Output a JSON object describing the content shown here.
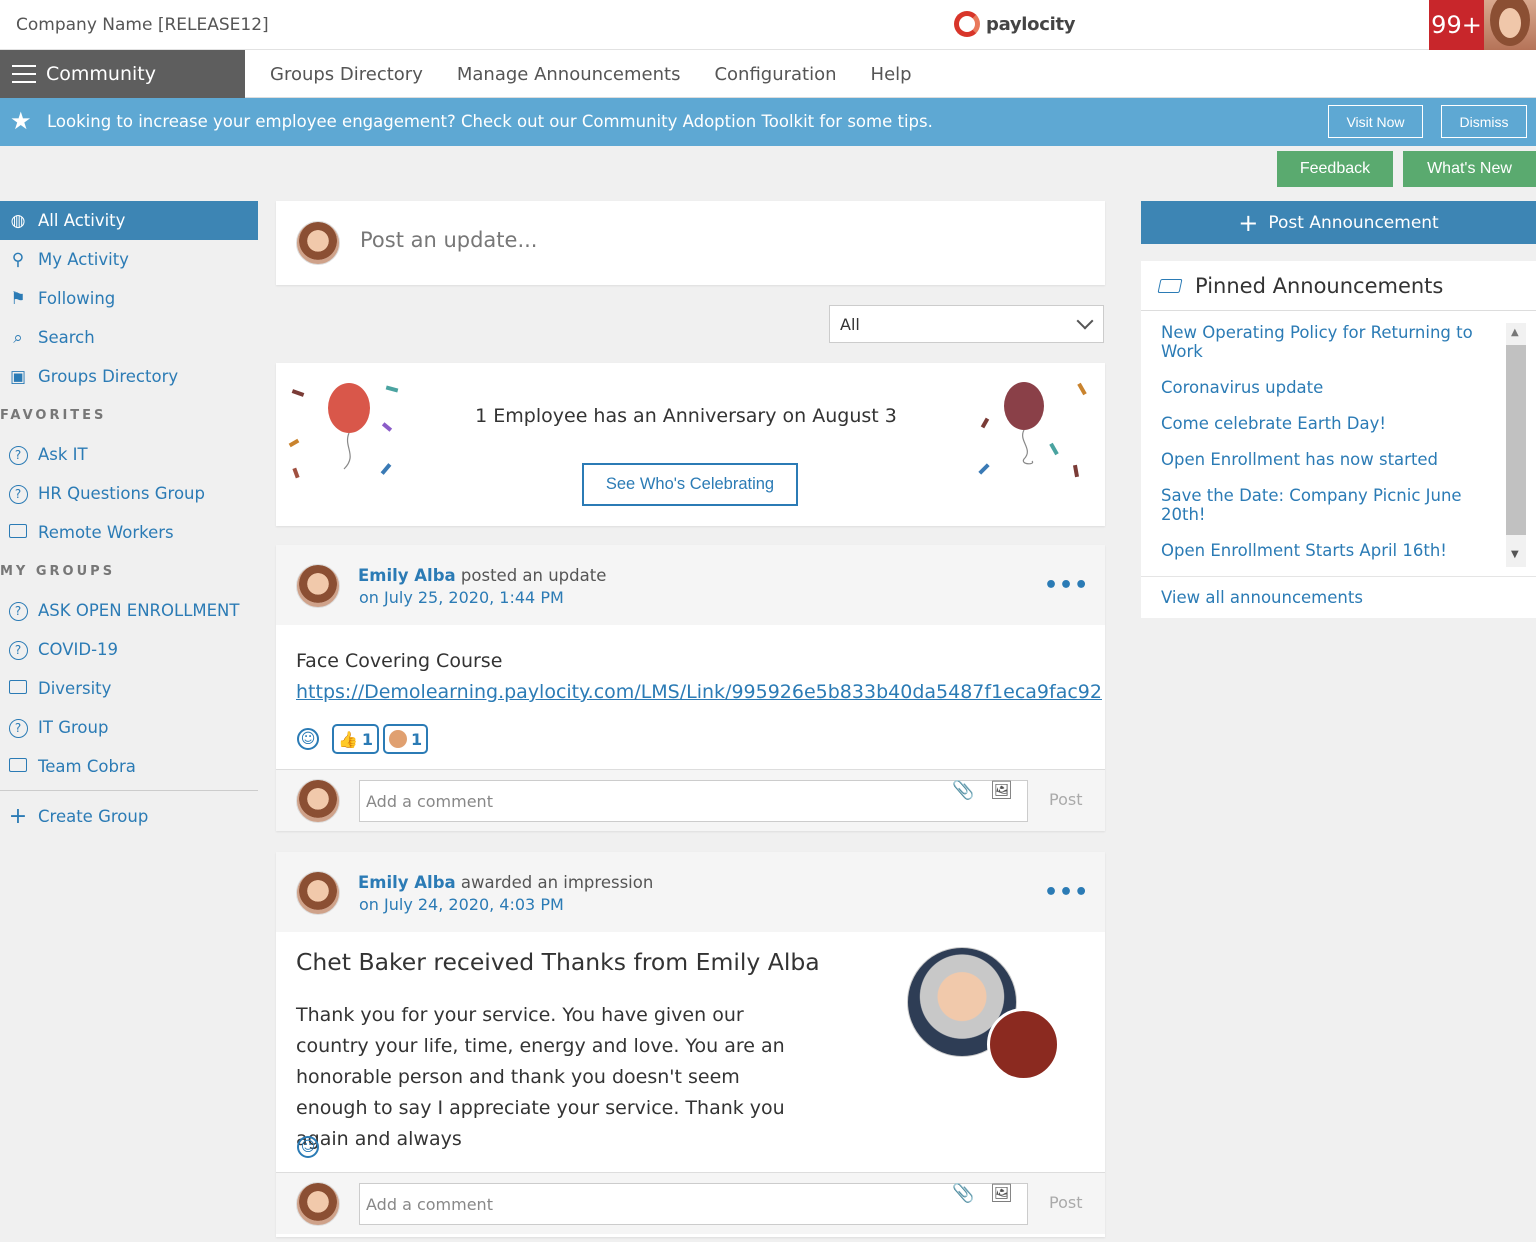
{
  "topbar": {
    "company": "Company Name [RELEASE12]",
    "brand": "paylocity",
    "notif_count": "99+"
  },
  "nav": {
    "community": "Community",
    "links": [
      "Groups Directory",
      "Manage Announcements",
      "Configuration",
      "Help"
    ]
  },
  "banner": {
    "text": "Looking to increase your employee engagement? Check out our Community Adoption Toolkit for some tips.",
    "visit": "Visit Now",
    "dismiss": "Dismiss"
  },
  "actions": {
    "feedback": "Feedback",
    "whats_new": "What's New"
  },
  "sidebar": {
    "main": [
      "All Activity",
      "My Activity",
      "Following",
      "Search",
      "Groups Directory"
    ],
    "favorites_head": "FAVORITES",
    "favorites": [
      "Ask IT",
      "HR Questions Group",
      "Remote Workers"
    ],
    "groups_head": "MY GROUPS",
    "groups": [
      "ASK OPEN ENROLLMENT",
      "COVID-19",
      "Diversity",
      "IT Group",
      "Team Cobra"
    ],
    "create": "Create Group"
  },
  "feed": {
    "post_placeholder": "Post an update...",
    "filter_value": "All",
    "anniversary_text": "1 Employee has an Anniversary on August 3",
    "celebrate_button": "See Who's Celebrating",
    "comment_placeholder": "Add a comment",
    "comment_post": "Post"
  },
  "posts": [
    {
      "author": "Emily Alba",
      "action": "posted an update",
      "date": "on July 25, 2020, 1:44 PM",
      "title": "Face Covering Course",
      "link": "https://Demolearning.paylocity.com/LMS/Link/995926e5b833b40da5487f1eca9fac92",
      "reactions": [
        {
          "count": "1"
        },
        {
          "count": "1"
        }
      ]
    },
    {
      "author": "Emily Alba",
      "action": "awarded an impression",
      "date": "on July 24, 2020, 4:03 PM",
      "title": "Chet Baker received Thanks from Emily Alba",
      "body": "Thank you for your service. You have given our country your life, time, energy and love. You are an honorable person and thank you doesn't seem enough to say I appreciate your service. Thank you again and always"
    }
  ],
  "right": {
    "post_announcement": "Post Announcement",
    "pinned_title": "Pinned Announcements",
    "announcements": [
      "New Operating Policy for Returning to Work",
      "Coronavirus update",
      "Come celebrate Earth Day!",
      "Open Enrollment has now started",
      "Save the Date: Company Picnic June 20th!",
      "Open Enrollment Starts April 16th!"
    ],
    "view_all": "View all announcements"
  },
  "colors": {
    "accent": "#3d85b4",
    "banner": "#5ea8d3",
    "green": "#5aaa6f",
    "badge": "#c8262b"
  }
}
